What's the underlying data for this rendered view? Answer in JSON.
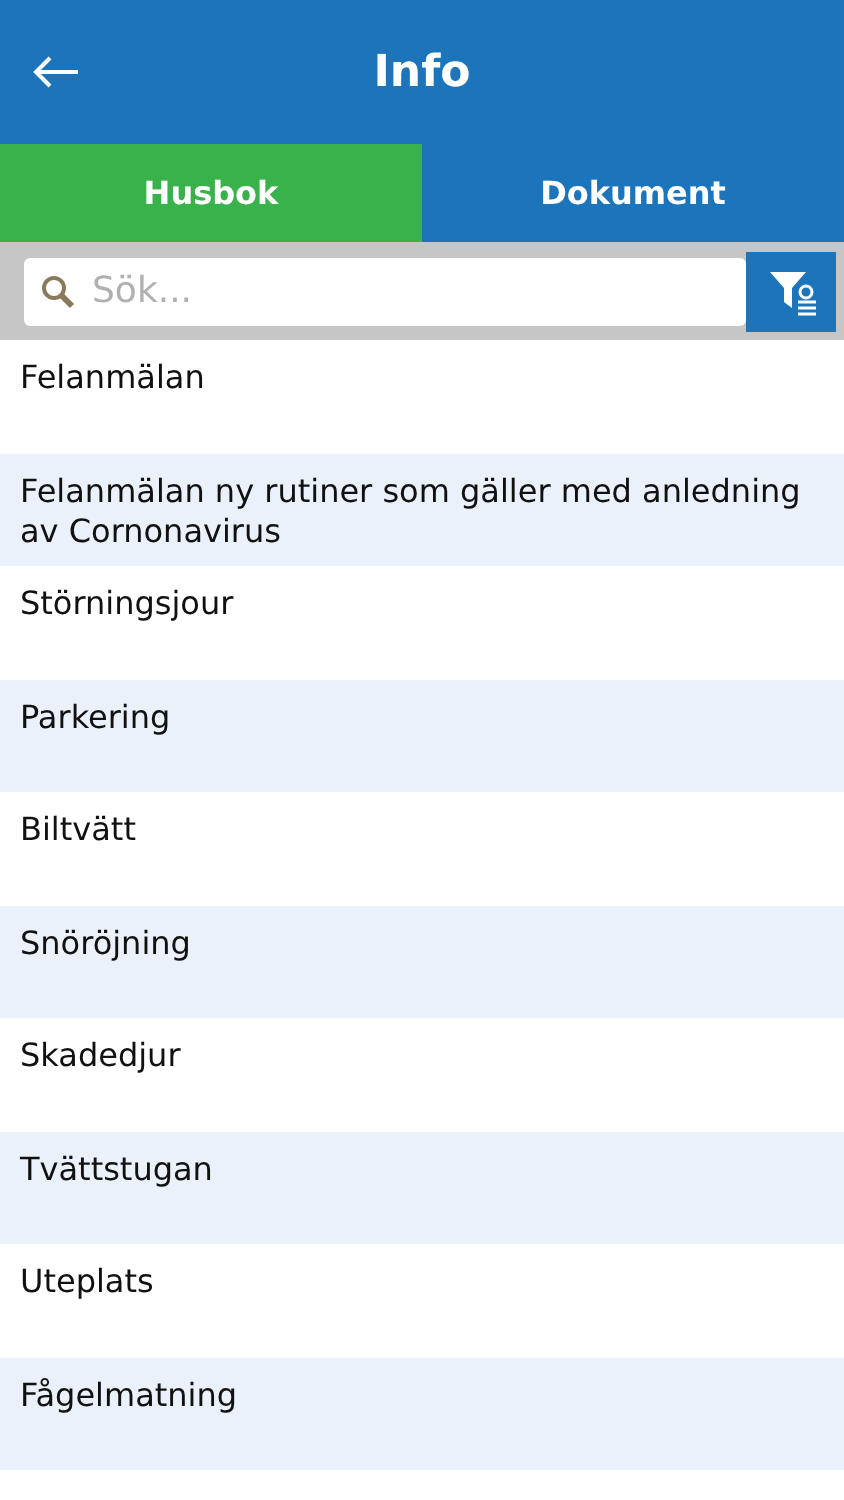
{
  "header": {
    "title": "Info"
  },
  "tabs": [
    {
      "label": "Husbok",
      "selected": true
    },
    {
      "label": "Dokument",
      "selected": false
    }
  ],
  "search": {
    "placeholder": "Sök..."
  },
  "items": [
    "Felanmälan",
    "Felanmälan ny rutiner som gäller med anledning av Cornonavirus",
    "Störningsjour",
    "Parkering",
    "Biltvätt",
    "Snöröjning",
    "Skadedjur",
    "Tvättstugan",
    "Uteplats",
    "Fågelmatning"
  ]
}
